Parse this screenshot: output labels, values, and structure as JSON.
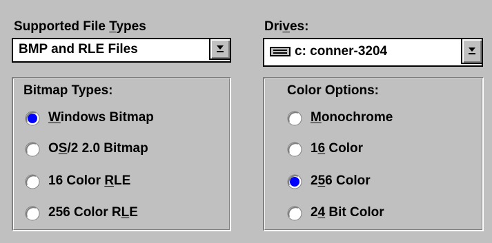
{
  "file_types": {
    "label_pre": "Supported File ",
    "label_ul": "T",
    "label_post": "ypes",
    "selected": "BMP and RLE Files",
    "dropdown_icon": "dropdown-arrow-icon"
  },
  "drives": {
    "label_pre": "Dri",
    "label_ul": "v",
    "label_post": "es:",
    "selected": "c: conner-3204",
    "drive_icon": "hard-drive-icon",
    "dropdown_icon": "dropdown-arrow-icon"
  },
  "bitmap_types": {
    "title": "Bitmap Types:",
    "options": [
      {
        "pre": "",
        "ul": "W",
        "post": "indows Bitmap",
        "selected": true
      },
      {
        "pre": "O",
        "ul": "S",
        "post": "/2 2.0 Bitmap",
        "selected": false
      },
      {
        "pre": "16 Color ",
        "ul": "R",
        "post": "LE",
        "selected": false
      },
      {
        "pre": "256 Color R",
        "ul": "L",
        "post": "E",
        "selected": false
      }
    ]
  },
  "color_options": {
    "title": "Color Options:",
    "options": [
      {
        "pre": "",
        "ul": "M",
        "post": "onochrome",
        "selected": false
      },
      {
        "pre": "1",
        "ul": "6",
        "post": " Color",
        "selected": false
      },
      {
        "pre": "2",
        "ul": "5",
        "post": "6 Color",
        "selected": true
      },
      {
        "pre": "2",
        "ul": "4",
        "post": " Bit Color",
        "selected": false
      }
    ]
  },
  "colors": {
    "background": "#c0c0c0",
    "radio_selected": "#0000ff"
  }
}
